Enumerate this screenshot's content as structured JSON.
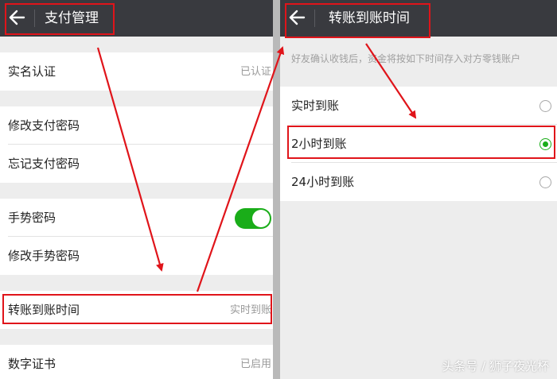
{
  "left_screen": {
    "title": "支付管理",
    "rows": [
      {
        "label": "实名认证",
        "value": "已认证"
      },
      {
        "label": "修改支付密码"
      },
      {
        "label": "忘记支付密码"
      },
      {
        "label": "手势密码",
        "toggle": "on"
      },
      {
        "label": "修改手势密码"
      },
      {
        "label": "转账到账时间",
        "value": "实时到账"
      },
      {
        "label": "数字证书",
        "value": "已启用"
      }
    ]
  },
  "right_screen": {
    "title": "转账到账时间",
    "hint": "好友确认收钱后，资金将按如下时间存入对方零钱账户",
    "options": [
      {
        "label": "实时到账",
        "selected": false
      },
      {
        "label": "2小时到账",
        "selected": true
      },
      {
        "label": "24小时到账",
        "selected": false
      }
    ]
  },
  "watermark": "头条号 / 狮子夜光杯",
  "colors": {
    "topbar": "#393a3f",
    "toggle_on": "#1aad19",
    "radio_selected": "#1aad19",
    "annotation_red": "#e0141a",
    "background": "#ededed"
  },
  "icons": {
    "back": "arrow-left-icon"
  }
}
